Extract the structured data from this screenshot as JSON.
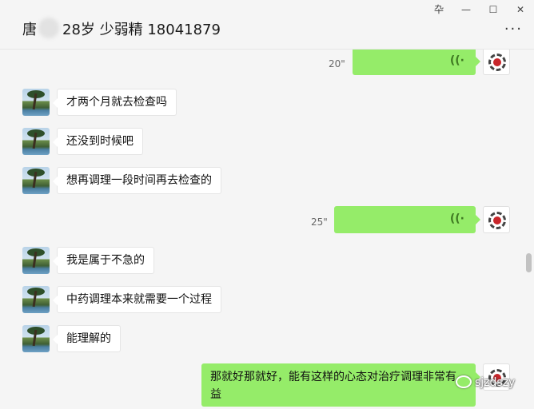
{
  "header": {
    "title_prefix": "唐",
    "title_suffix": "28岁 少弱精 18041879",
    "more_label": "···"
  },
  "window_controls": {
    "pin": "卆",
    "minimize": "—",
    "maximize": "☐",
    "close": "✕"
  },
  "messages": [
    {
      "side": "right",
      "type": "voice",
      "duration": "20\""
    },
    {
      "side": "left",
      "type": "text",
      "text": "才两个月就去检查吗"
    },
    {
      "side": "left",
      "type": "text",
      "text": "还没到时候吧"
    },
    {
      "side": "left",
      "type": "text",
      "text": "想再调理一段时间再去检查的"
    },
    {
      "side": "right",
      "type": "voice",
      "duration": "25\""
    },
    {
      "side": "left",
      "type": "text",
      "text": "我是属于不急的"
    },
    {
      "side": "left",
      "type": "text",
      "text": "中药调理本来就需要一个过程"
    },
    {
      "side": "left",
      "type": "text",
      "text": "能理解的"
    },
    {
      "side": "right",
      "type": "text",
      "text_line1": "那就好那就好，能有这样的心态对治疗调理非常有益",
      "text_line2": "。"
    }
  ],
  "voice_icon": "((·",
  "watermark": "sjzdszy",
  "colors": {
    "sent_bubble": "#95ec69",
    "received_bubble": "#ffffff",
    "background": "#f5f5f5"
  }
}
